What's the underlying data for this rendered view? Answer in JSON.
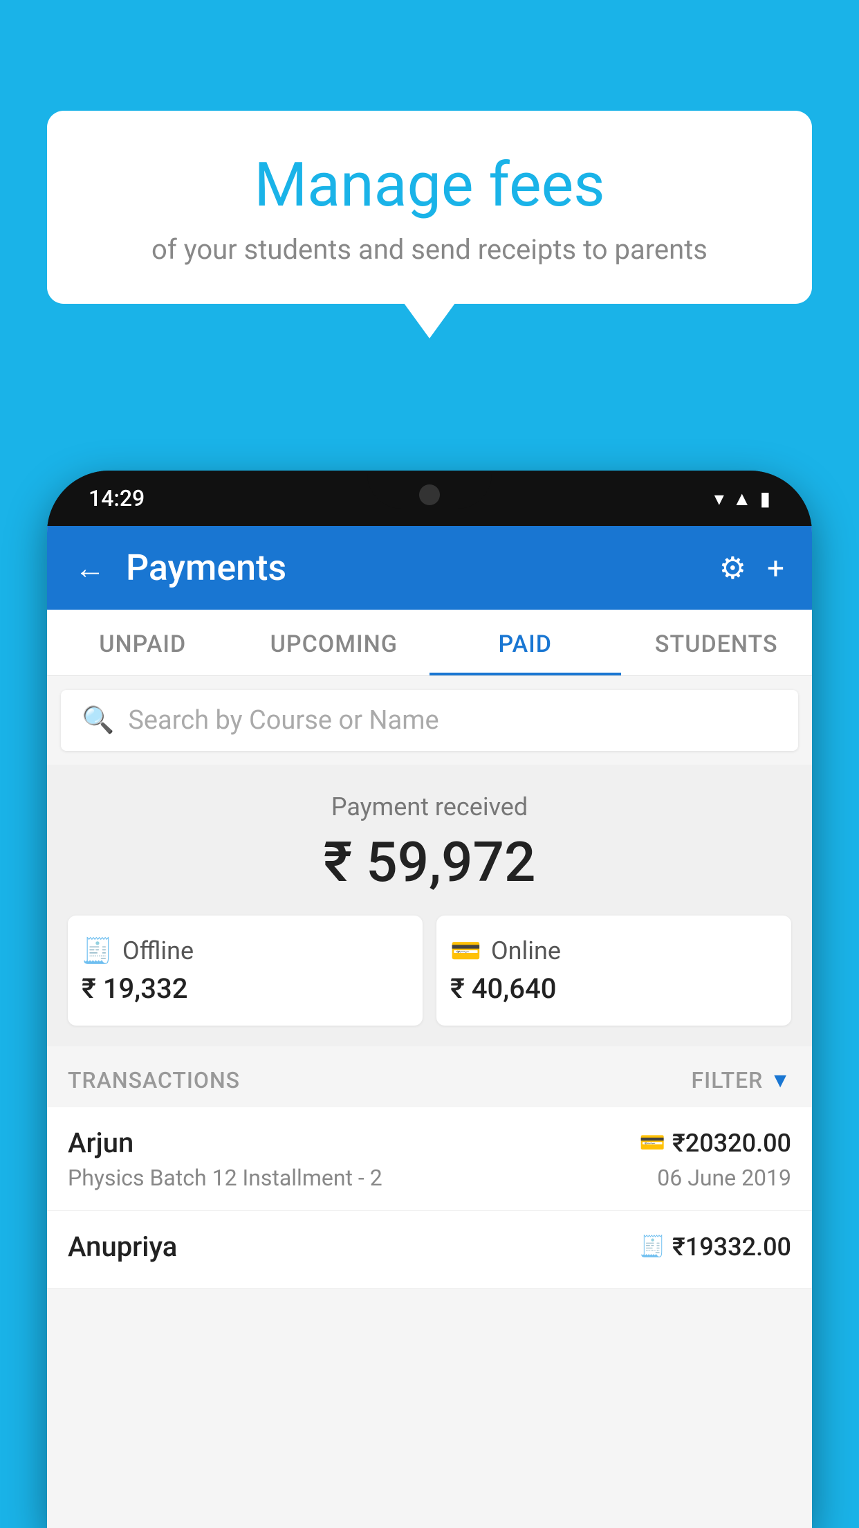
{
  "background_color": "#1ab3e8",
  "bubble": {
    "title": "Manage fees",
    "subtitle": "of your students and send receipts to parents"
  },
  "phone": {
    "status_bar": {
      "time": "14:29"
    },
    "header": {
      "title": "Payments",
      "back_label": "←",
      "settings_label": "⚙",
      "add_label": "+"
    },
    "tabs": [
      {
        "label": "UNPAID",
        "active": false
      },
      {
        "label": "UPCOMING",
        "active": false
      },
      {
        "label": "PAID",
        "active": true
      },
      {
        "label": "STUDENTS",
        "active": false
      }
    ],
    "search": {
      "placeholder": "Search by Course or Name"
    },
    "payment_summary": {
      "label": "Payment received",
      "amount": "₹ 59,972",
      "offline": {
        "label": "Offline",
        "amount": "₹ 19,332"
      },
      "online": {
        "label": "Online",
        "amount": "₹ 40,640"
      }
    },
    "transactions": {
      "section_label": "TRANSACTIONS",
      "filter_label": "FILTER",
      "items": [
        {
          "name": "Arjun",
          "course": "Physics Batch 12 Installment - 2",
          "amount": "₹20320.00",
          "date": "06 June 2019",
          "type": "online"
        },
        {
          "name": "Anupriya",
          "course": "",
          "amount": "₹19332.00",
          "date": "",
          "type": "offline"
        }
      ]
    }
  }
}
